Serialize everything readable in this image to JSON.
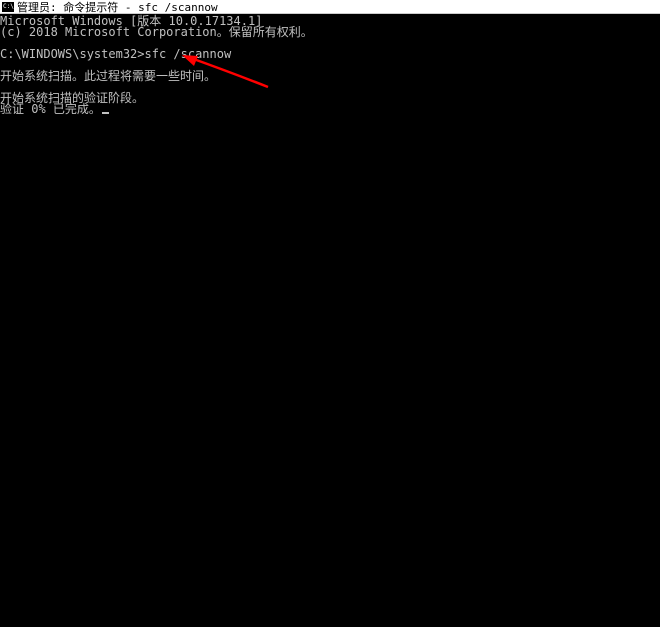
{
  "titlebar": {
    "text": "管理员: 命令提示符 - sfc  /scannow"
  },
  "terminal": {
    "line1": "Microsoft Windows [版本 10.0.17134.1]",
    "line2": "(c) 2018 Microsoft Corporation。保留所有权利。",
    "prompt": "C:\\WINDOWS\\system32>",
    "command": "sfc /scannow",
    "line4": "开始系统扫描。此过程将需要一些时间。",
    "line5": "开始系统扫描的验证阶段。",
    "line6": "验证 0% 已完成。"
  },
  "annotation": {
    "arrow_color": "#ff0000"
  }
}
